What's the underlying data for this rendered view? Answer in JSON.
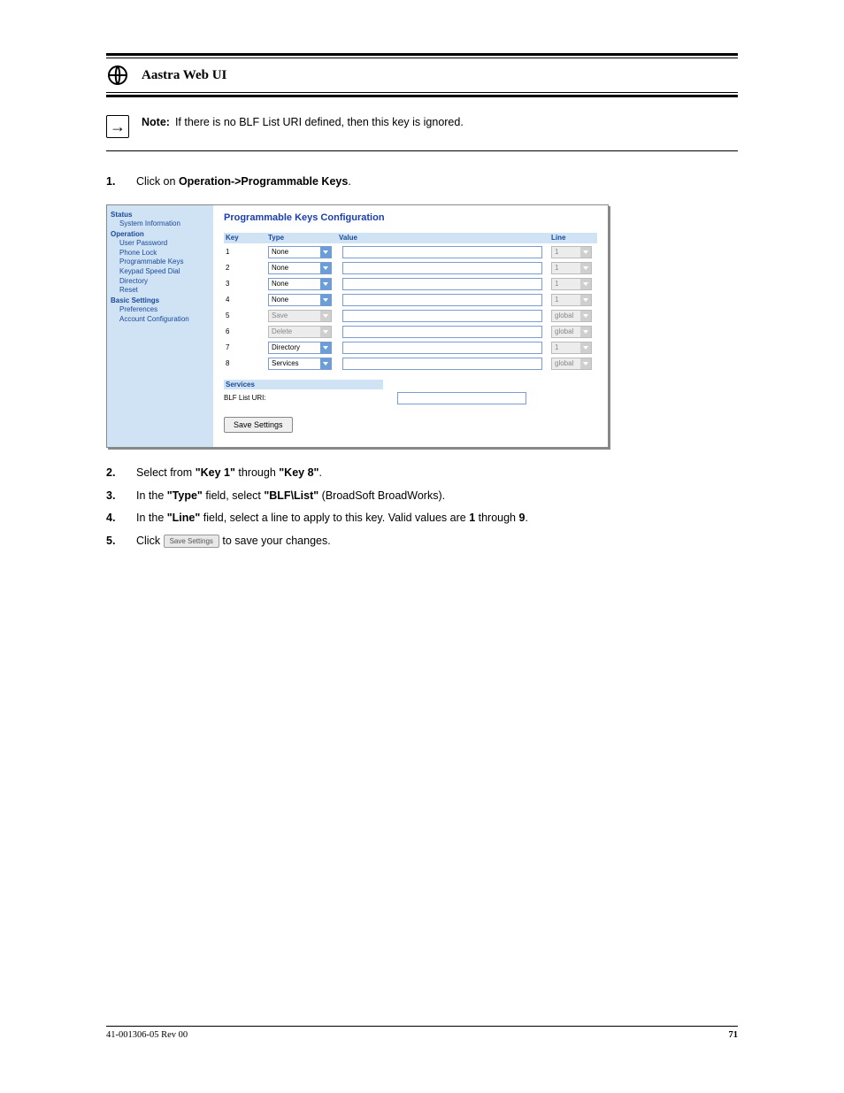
{
  "icons": {
    "web_label": "Aastra Web UI",
    "note_label": "Note:",
    "note_text": "If there is no BLF List URI defined, then this key is ignored."
  },
  "steps": {
    "s1_a": "Click on ",
    "s1_b": "Operation->Programmable Keys",
    "s1_c": ".",
    "s2_a": "Select from ",
    "s2_b": "\"Key 1\"",
    "s2_c": " through ",
    "s2_d": "\"Key 8\"",
    "s2_e": ".",
    "s3_a": "In the ",
    "s3_b": "\"Type\"",
    "s3_c": " field, select ",
    "s3_d": "\"BLF\\List\"",
    "s3_e": " (BroadSoft BroadWorks).",
    "s4_a": "In the ",
    "s4_b": "\"Line\"",
    "s4_c": " field, select a line to apply to this key. Valid values are ",
    "s4_d": "1",
    "s4_e": " through ",
    "s4_f": "9",
    "s4_g": ".",
    "s5_a": "Click  ",
    "s5_b": "  to save your changes."
  },
  "inline_save_btn": "Save Settings",
  "ui": {
    "sidebar": {
      "status": "Status",
      "sysinfo": "System Information",
      "operation": "Operation",
      "userpw": "User Password",
      "phonelock": "Phone Lock",
      "progkeys": "Programmable Keys",
      "keypad": "Keypad Speed Dial",
      "directory": "Directory",
      "reset": "Reset",
      "basic": "Basic Settings",
      "prefs": "Preferences",
      "acct": "Account Configuration"
    },
    "title": "Programmable Keys Configuration",
    "headers": {
      "key": "Key",
      "type": "Type",
      "value": "Value",
      "line": "Line"
    },
    "rows": [
      {
        "key": "1",
        "type": "None",
        "type_enabled": true,
        "line": "1",
        "line_enabled": false
      },
      {
        "key": "2",
        "type": "None",
        "type_enabled": true,
        "line": "1",
        "line_enabled": false
      },
      {
        "key": "3",
        "type": "None",
        "type_enabled": true,
        "line": "1",
        "line_enabled": false
      },
      {
        "key": "4",
        "type": "None",
        "type_enabled": true,
        "line": "1",
        "line_enabled": false
      },
      {
        "key": "5",
        "type": "Save",
        "type_enabled": false,
        "line": "global",
        "line_enabled": false
      },
      {
        "key": "6",
        "type": "Delete",
        "type_enabled": false,
        "line": "global",
        "line_enabled": false
      },
      {
        "key": "7",
        "type": "Directory",
        "type_enabled": true,
        "line": "1",
        "line_enabled": false
      },
      {
        "key": "8",
        "type": "Services",
        "type_enabled": true,
        "line": "global",
        "line_enabled": false
      }
    ],
    "services_hdr": "Services",
    "blf_label": "BLF List URI:",
    "save_btn": "Save Settings"
  },
  "footer": {
    "left": "41-001306-05 Rev 00",
    "right": "71"
  }
}
